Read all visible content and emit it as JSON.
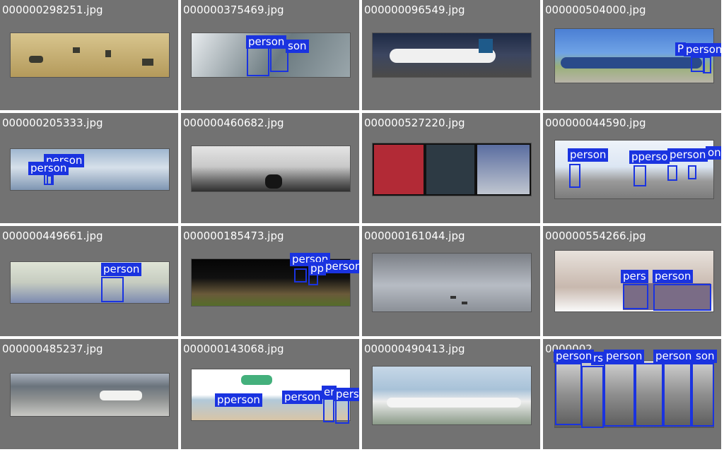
{
  "tiles": [
    {
      "filename": "000000298251.jpg",
      "labels": []
    },
    {
      "filename": "000000375469.jpg",
      "labels": [
        "person",
        "son"
      ]
    },
    {
      "filename": "000000096549.jpg",
      "labels": []
    },
    {
      "filename": "000000504000.jpg",
      "labels": [
        "P",
        "person"
      ]
    },
    {
      "filename": "000000205333.jpg",
      "labels": [
        "person",
        "person"
      ]
    },
    {
      "filename": "000000460682.jpg",
      "labels": []
    },
    {
      "filename": "000000527220.jpg",
      "labels": []
    },
    {
      "filename": "000000044590.jpg",
      "labels": [
        "person",
        "pperso",
        "person",
        "on"
      ]
    },
    {
      "filename": "000000449661.jpg",
      "labels": [
        "person"
      ]
    },
    {
      "filename": "000000185473.jpg",
      "labels": [
        "person",
        "pp",
        "person"
      ]
    },
    {
      "filename": "000000161044.jpg",
      "labels": []
    },
    {
      "filename": "000000554266.jpg",
      "labels": [
        "pers",
        "person"
      ]
    },
    {
      "filename": "000000485237.jpg",
      "labels": []
    },
    {
      "filename": "000000143068.jpg",
      "labels": [
        "pperson",
        "person",
        "er",
        "person"
      ]
    },
    {
      "filename": "000000490413.jpg",
      "labels": []
    },
    {
      "filename": "0000002",
      "labels": [
        "person",
        "rs",
        "person",
        "person",
        "son"
      ]
    }
  ],
  "colors": {
    "tile_bg": "#727272",
    "detection": "#1a33e0",
    "separator": "#ffffff"
  }
}
